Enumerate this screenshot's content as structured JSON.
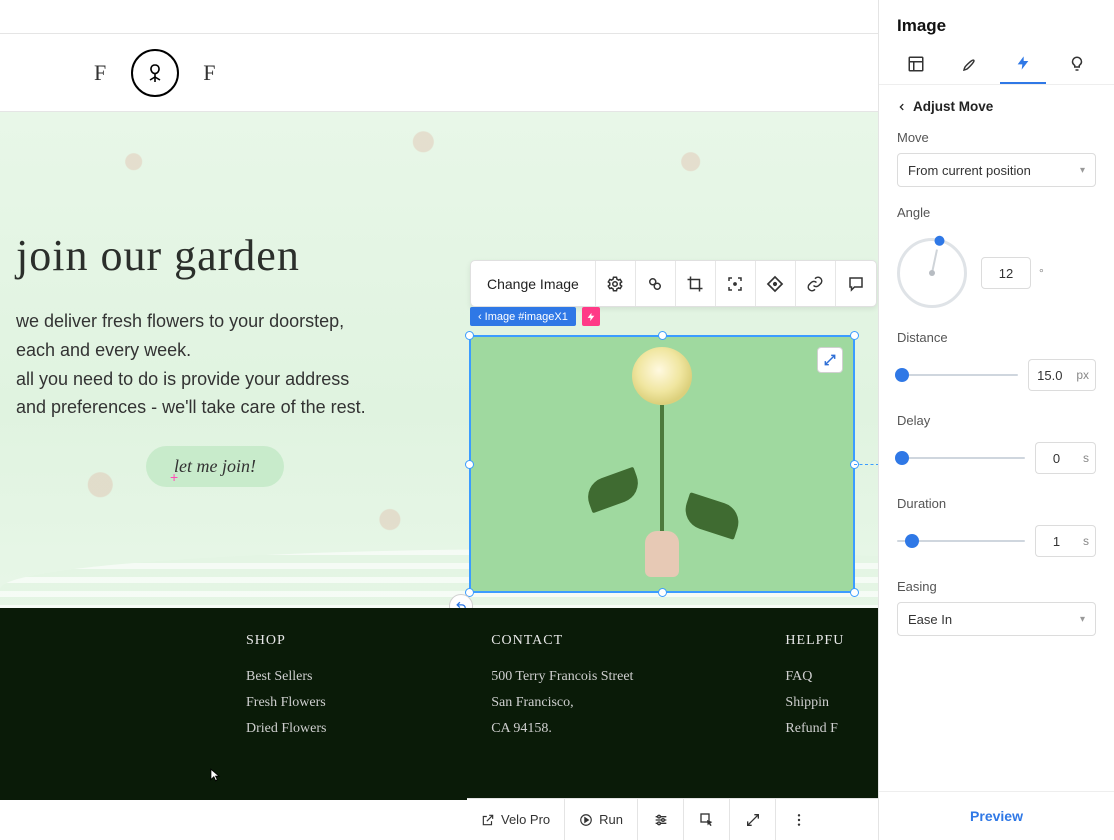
{
  "header": {
    "logo_left_letter": "F",
    "logo_right_letter": "F"
  },
  "imageToolbar": {
    "change_image": "Change Image"
  },
  "elementBadge": {
    "label": "Image #imageX1"
  },
  "hero": {
    "title": "join our garden",
    "line1": "we deliver fresh flowers to your doorstep,",
    "line2": "each and every week.",
    "line3": "all you need to do is provide your address",
    "line4": "and preferences - we'll take care of the rest.",
    "cta": "let me join!"
  },
  "footer": {
    "shop_heading": "SHOP",
    "shop_links": [
      "Best Sellers",
      "Fresh Flowers",
      "Dried Flowers"
    ],
    "contact_heading": "CONTACT",
    "contact_lines": [
      "500 Terry Francois Street",
      "San Francisco,",
      "CA 94158."
    ],
    "links_heading": "HELPFU",
    "links_items": [
      "FAQ",
      "Shippin",
      "Refund F"
    ]
  },
  "bottomToolbar": {
    "velo": "Velo Pro",
    "run": "Run"
  },
  "panel": {
    "title": "Image",
    "back_label": "Adjust Move",
    "move_label": "Move",
    "move_value": "From current position",
    "angle_label": "Angle",
    "angle_value": "12",
    "angle_unit": "°",
    "distance_label": "Distance",
    "distance_value": "15.0",
    "distance_unit": "px",
    "delay_label": "Delay",
    "delay_value": "0",
    "delay_unit": "s",
    "duration_label": "Duration",
    "duration_value": "1",
    "duration_unit": "s",
    "easing_label": "Easing",
    "easing_value": "Ease In",
    "preview": "Preview"
  }
}
